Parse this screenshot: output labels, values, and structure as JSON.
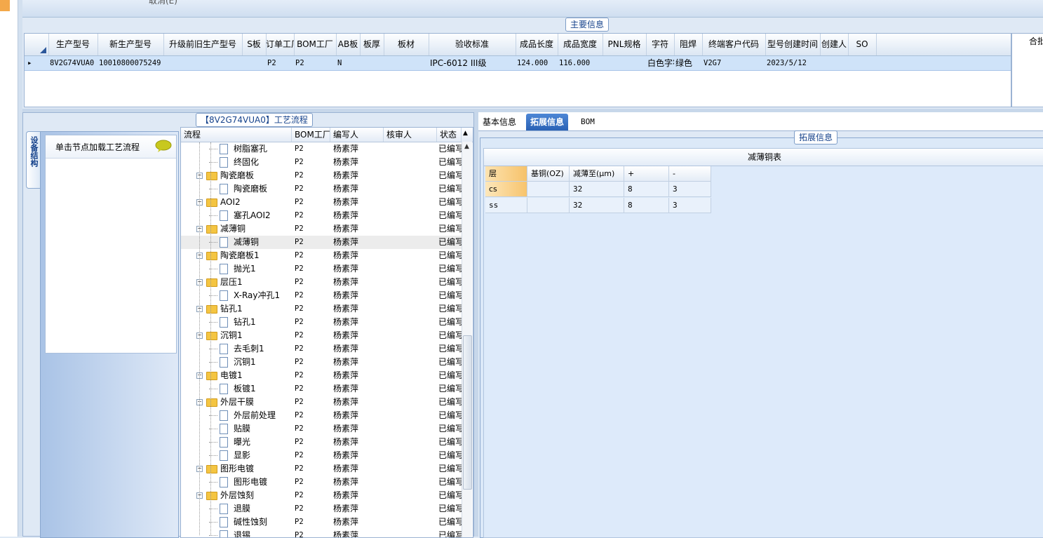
{
  "topbar": {
    "cut_text": "取消(E)"
  },
  "main_info": {
    "group_title": "主要信息",
    "columns": [
      "生产型号",
      "新生产型号",
      "升级前旧生产型号",
      "S板",
      "订单工厂",
      "BOM工厂",
      "AB板",
      "板厚",
      "板材",
      "验收标准",
      "成品长度",
      "成品宽度",
      "PNL规格",
      "字符",
      "阻焊",
      "终端客户代码",
      "型号创建时间",
      "创建人",
      "SO"
    ],
    "row": [
      "8V2G74VUA0",
      "10010800075249",
      "",
      "",
      "P2",
      "P2",
      "N",
      "",
      "",
      "IPC-6012 III级",
      "124.000",
      "116.000",
      "",
      "白色字符",
      "绿色",
      "V2G7",
      "2023/5/12",
      "",
      ""
    ],
    "side_label": "合批"
  },
  "flow_panel": {
    "group_title": "【8V2G74VUA0】工艺流程",
    "side_tab": "设备结构",
    "hint": "单击节点加载工艺流程",
    "columns": [
      "流程",
      "BOM工厂",
      "编写人",
      "核审人",
      "状态"
    ],
    "rows": [
      {
        "name": "树脂塞孔",
        "bom": "P2",
        "writer": "杨素萍",
        "reviewer": "",
        "status": "已编写",
        "level": 2
      },
      {
        "name": "终固化",
        "bom": "P2",
        "writer": "杨素萍",
        "reviewer": "",
        "status": "已编写",
        "level": 2
      },
      {
        "name": "陶瓷磨板",
        "bom": "P2",
        "writer": "杨素萍",
        "reviewer": "",
        "status": "已编写",
        "level": 1
      },
      {
        "name": "陶瓷磨板",
        "bom": "P2",
        "writer": "杨素萍",
        "reviewer": "",
        "status": "已编写",
        "level": 2
      },
      {
        "name": "AOI2",
        "bom": "P2",
        "writer": "杨素萍",
        "reviewer": "",
        "status": "已编写",
        "level": 1
      },
      {
        "name": "塞孔AOI2",
        "bom": "P2",
        "writer": "杨素萍",
        "reviewer": "",
        "status": "已编写",
        "level": 2
      },
      {
        "name": "减薄铜",
        "bom": "P2",
        "writer": "杨素萍",
        "reviewer": "",
        "status": "已编写",
        "level": 1
      },
      {
        "name": "减薄铜",
        "bom": "P2",
        "writer": "杨素萍",
        "reviewer": "",
        "status": "已编写",
        "level": 2,
        "selected": true
      },
      {
        "name": "陶瓷磨板1",
        "bom": "P2",
        "writer": "杨素萍",
        "reviewer": "",
        "status": "已编写",
        "level": 1
      },
      {
        "name": "抛光1",
        "bom": "P2",
        "writer": "杨素萍",
        "reviewer": "",
        "status": "已编写",
        "level": 2
      },
      {
        "name": "层压1",
        "bom": "P2",
        "writer": "杨素萍",
        "reviewer": "",
        "status": "已编写",
        "level": 1
      },
      {
        "name": "X-Ray冲孔1",
        "bom": "P2",
        "writer": "杨素萍",
        "reviewer": "",
        "status": "已编写",
        "level": 2
      },
      {
        "name": "钻孔1",
        "bom": "P2",
        "writer": "杨素萍",
        "reviewer": "",
        "status": "已编写",
        "level": 1
      },
      {
        "name": "钻孔1",
        "bom": "P2",
        "writer": "杨素萍",
        "reviewer": "",
        "status": "已编写",
        "level": 2
      },
      {
        "name": "沉铜1",
        "bom": "P2",
        "writer": "杨素萍",
        "reviewer": "",
        "status": "已编写",
        "level": 1
      },
      {
        "name": "去毛刺1",
        "bom": "P2",
        "writer": "杨素萍",
        "reviewer": "",
        "status": "已编写",
        "level": 2
      },
      {
        "name": "沉铜1",
        "bom": "P2",
        "writer": "杨素萍",
        "reviewer": "",
        "status": "已编写",
        "level": 2
      },
      {
        "name": "电镀1",
        "bom": "P2",
        "writer": "杨素萍",
        "reviewer": "",
        "status": "已编写",
        "level": 1
      },
      {
        "name": "板镀1",
        "bom": "P2",
        "writer": "杨素萍",
        "reviewer": "",
        "status": "已编写",
        "level": 2
      },
      {
        "name": "外层干膜",
        "bom": "P2",
        "writer": "杨素萍",
        "reviewer": "",
        "status": "已编写",
        "level": 1
      },
      {
        "name": "外层前处理",
        "bom": "P2",
        "writer": "杨素萍",
        "reviewer": "",
        "status": "已编写",
        "level": 2
      },
      {
        "name": "贴膜",
        "bom": "P2",
        "writer": "杨素萍",
        "reviewer": "",
        "status": "已编写",
        "level": 2
      },
      {
        "name": "曝光",
        "bom": "P2",
        "writer": "杨素萍",
        "reviewer": "",
        "status": "已编写",
        "level": 2
      },
      {
        "name": "显影",
        "bom": "P2",
        "writer": "杨素萍",
        "reviewer": "",
        "status": "已编写",
        "level": 2
      },
      {
        "name": "图形电镀",
        "bom": "P2",
        "writer": "杨素萍",
        "reviewer": "",
        "status": "已编写",
        "level": 1
      },
      {
        "name": "图形电镀",
        "bom": "P2",
        "writer": "杨素萍",
        "reviewer": "",
        "status": "已编写",
        "level": 2
      },
      {
        "name": "外层蚀刻",
        "bom": "P2",
        "writer": "杨素萍",
        "reviewer": "",
        "status": "已编写",
        "level": 1
      },
      {
        "name": "退膜",
        "bom": "P2",
        "writer": "杨素萍",
        "reviewer": "",
        "status": "已编写",
        "level": 2
      },
      {
        "name": "碱性蚀刻",
        "bom": "P2",
        "writer": "杨素萍",
        "reviewer": "",
        "status": "已编写",
        "level": 2
      },
      {
        "name": "退锡",
        "bom": "P2",
        "writer": "杨素萍",
        "reviewer": "",
        "status": "已编写",
        "level": 2
      }
    ]
  },
  "right_panel": {
    "tabs": [
      "基本信息",
      "拓展信息",
      "BOM"
    ],
    "active_tab": "拓展信息",
    "group_title": "拓展信息",
    "table_title": "减薄铜表",
    "table_columns": [
      "层",
      "基铜(OZ)",
      "减薄至(μm)",
      "+",
      "-"
    ],
    "table_rows": [
      [
        "cs",
        "",
        "32",
        "8",
        "3"
      ],
      [
        "ss",
        "",
        "32",
        "8",
        "3"
      ]
    ]
  },
  "colors": {
    "accent": "#2a62b5",
    "selected_row": "#cfe3f9",
    "folder": "#f4c542",
    "highlight": "#f6c26a"
  }
}
